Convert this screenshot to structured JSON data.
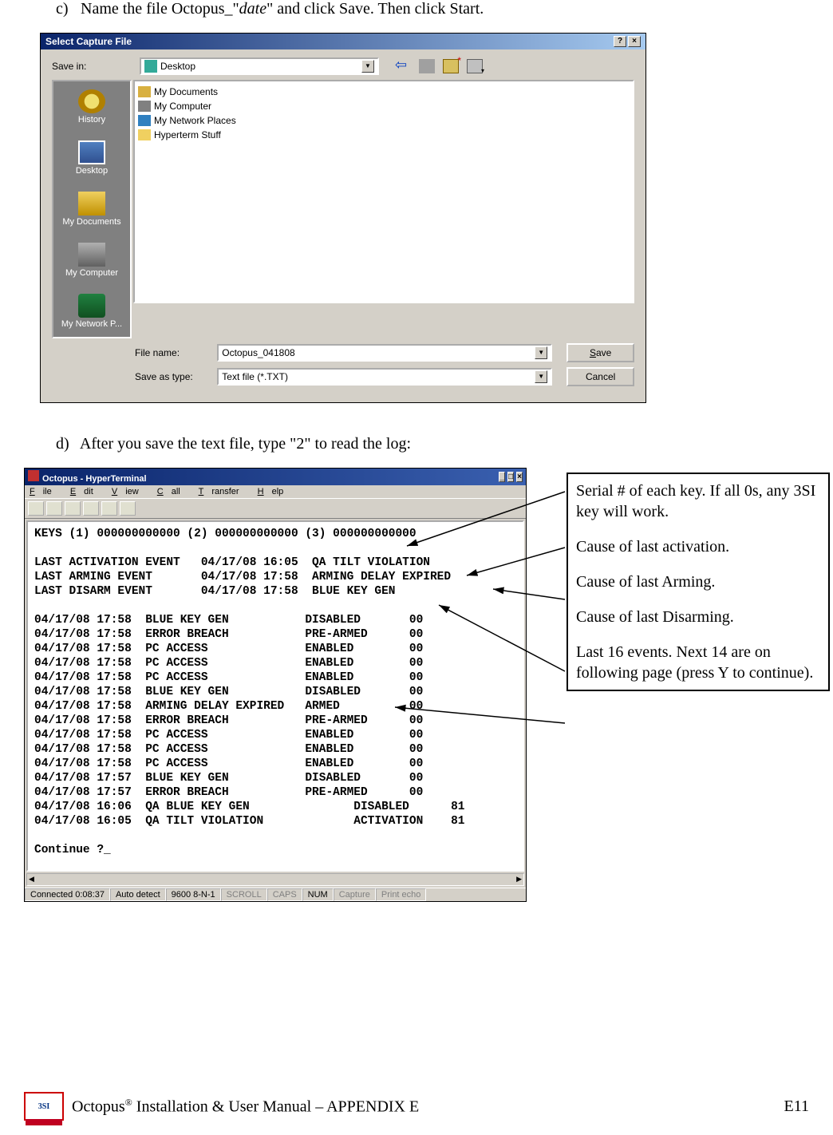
{
  "instr_c_idx": "c)",
  "instr_c_1": "Name the file Octopus_\"",
  "instr_c_2": "date",
  "instr_c_3": "\" and click Save. Then click Start.",
  "instr_d_idx": "d)",
  "instr_d": "After you save the text file, type \"2\" to read the log:",
  "dlg": {
    "title": "Select Capture File",
    "help": "?",
    "close": "×",
    "save_in_label": "Save in:",
    "save_in_value": "Desktop",
    "places": [
      "History",
      "Desktop",
      "My Documents",
      "My Computer",
      "My Network P..."
    ],
    "files": [
      "My Documents",
      "My Computer",
      "My Network Places",
      "Hyperterm Stuff"
    ],
    "file_name_label": "File name:",
    "file_name_value": "Octopus_041808",
    "save_type_label": "Save as type:",
    "save_type_value": "Text file (*.TXT)",
    "save_btn_pre": "S",
    "save_btn_rest": "ave",
    "cancel_btn": "Cancel"
  },
  "hyper": {
    "title": "Octopus - HyperTerminal",
    "minimize": "_",
    "maximize": "□",
    "close": "×",
    "menu_file": "File",
    "menu_edit": "Edit",
    "menu_view": "View",
    "menu_call": "Call",
    "menu_transfer": "Transfer",
    "menu_help": "Help",
    "term_text": "KEYS (1) 000000000000 (2) 000000000000 (3) 000000000000\n\nLAST ACTIVATION EVENT   04/17/08 16:05  QA TILT VIOLATION\nLAST ARMING EVENT       04/17/08 17:58  ARMING DELAY EXPIRED\nLAST DISARM EVENT       04/17/08 17:58  BLUE KEY GEN\n\n04/17/08 17:58  BLUE KEY GEN           DISABLED       00\n04/17/08 17:58  ERROR BREACH           PRE-ARMED      00\n04/17/08 17:58  PC ACCESS              ENABLED        00\n04/17/08 17:58  PC ACCESS              ENABLED        00\n04/17/08 17:58  PC ACCESS              ENABLED        00\n04/17/08 17:58  BLUE KEY GEN           DISABLED       00\n04/17/08 17:58  ARMING DELAY EXPIRED   ARMED          00\n04/17/08 17:58  ERROR BREACH           PRE-ARMED      00\n04/17/08 17:58  PC ACCESS              ENABLED        00\n04/17/08 17:58  PC ACCESS              ENABLED        00\n04/17/08 17:58  PC ACCESS              ENABLED        00\n04/17/08 17:57  BLUE KEY GEN           DISABLED       00\n04/17/08 17:57  ERROR BREACH           PRE-ARMED      00\n04/17/08 16:06  QA BLUE KEY GEN               DISABLED      81\n04/17/08 16:05  QA TILT VIOLATION             ACTIVATION    81\n\nContinue ?_",
    "status": {
      "conn": "Connected 0:08:37",
      "detect": "Auto detect",
      "baud": "9600 8-N-1",
      "scroll": "SCROLL",
      "caps": "CAPS",
      "num": "NUM",
      "capture": "Capture",
      "echo": "Print echo"
    }
  },
  "annot": {
    "a1": "Serial # of each key. If all 0s, any 3SI key will work.",
    "a2": "Cause of last activation.",
    "a3": "Cause of last Arming.",
    "a4": "Cause of last Disarming.",
    "a5": "Last 16 events. Next 14 are on following page (press Y to continue)."
  },
  "footer": {
    "text1": "Octopus",
    "reg": "®",
    "text2": " Installation & User Manual – APPENDIX E",
    "page": "E11"
  }
}
